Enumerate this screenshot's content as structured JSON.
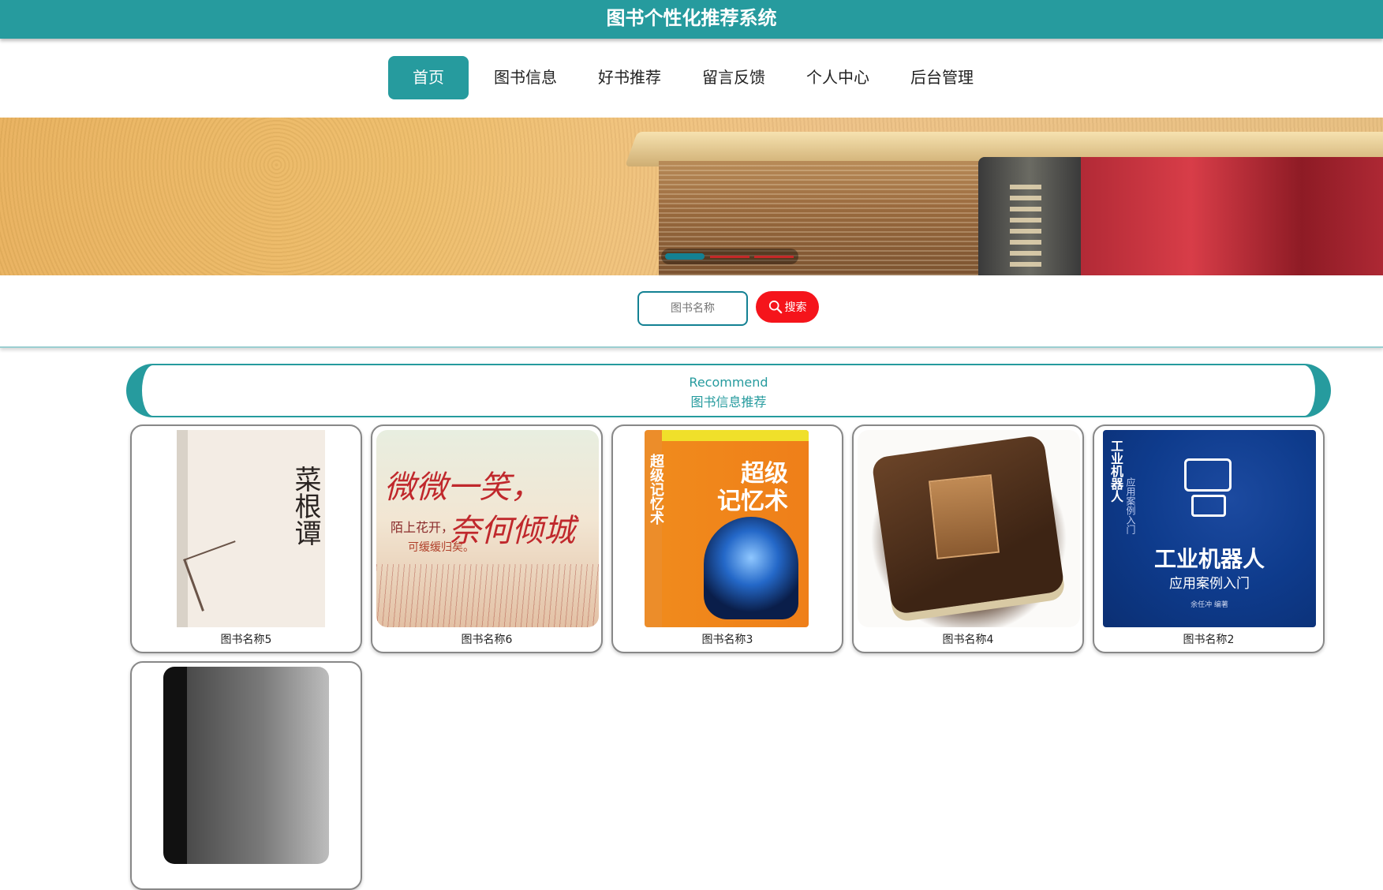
{
  "header": {
    "title": "图书个性化推荐系统"
  },
  "nav": {
    "items": [
      {
        "label": "首页",
        "active": true
      },
      {
        "label": "图书信息"
      },
      {
        "label": "好书推荐"
      },
      {
        "label": "留言反馈"
      },
      {
        "label": "个人中心"
      },
      {
        "label": "后台管理"
      }
    ]
  },
  "banner": {
    "slide_count": 3,
    "active_slide": 1
  },
  "search": {
    "placeholder": "图书名称",
    "button_label": "搜索"
  },
  "recommend": {
    "title_en": "Recommend",
    "title_cn": "图书信息推荐"
  },
  "books": [
    {
      "name": "图书名称5",
      "cover_text": "菜根谭"
    },
    {
      "name": "图书名称6",
      "cover_text_1": "微微一笑，",
      "cover_text_2": "陌上花开，",
      "cover_text_3": "奈何倾城",
      "cover_text_4": "可缓缓归矣。"
    },
    {
      "name": "图书名称3",
      "cover_title_1": "超级",
      "cover_title_2": "记忆术",
      "cover_spine": "超级记忆术"
    },
    {
      "name": "图书名称4"
    },
    {
      "name": "图书名称2",
      "cover_spine": "工业机器人",
      "cover_spine_sub": "应用案例入门",
      "cover_title": "工业机器人",
      "cover_subtitle": "应用案例入门",
      "cover_author": "余任冲 编著"
    },
    {
      "name": ""
    }
  ],
  "colors": {
    "primary": "#269b9e",
    "search_button": "#f5141b",
    "accent_dark": "#138193"
  }
}
